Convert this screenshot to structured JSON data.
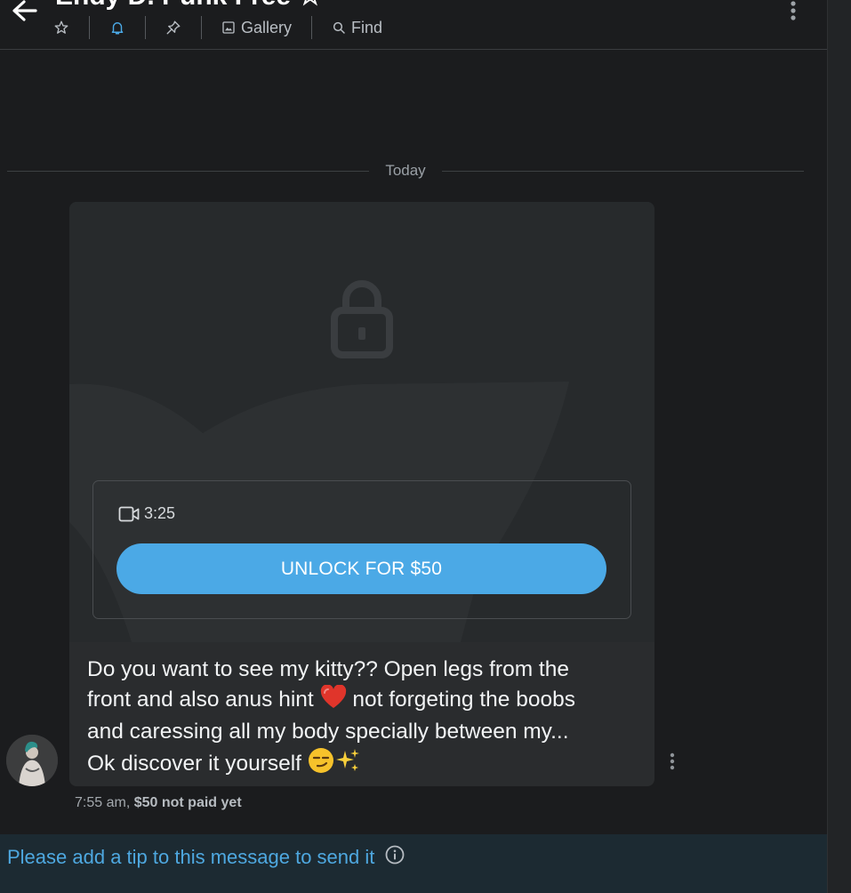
{
  "header": {
    "title": "Endy D. Punk Free ☆",
    "toolbar": {
      "gallery_label": "Gallery",
      "find_label": "Find"
    }
  },
  "chat": {
    "date_divider": "Today",
    "message": {
      "video_duration": "3:25",
      "unlock_label": "UNLOCK FOR $50",
      "text_lines": [
        "Do you want to see my kitty?? Open legs from the",
        "front and also anus hint",
        "not forgeting the boobs",
        "and caressing all my body specially between my...",
        "Ok discover it yourself"
      ],
      "time": "7:55 am,",
      "price_status": "$50 not paid yet"
    }
  },
  "footer": {
    "tip_notice": "Please add a tip to this message to send it"
  },
  "icons": {
    "back": "arrow-left-icon",
    "favorite": "star-icon",
    "notifications": "bell-icon",
    "pin": "pin-icon",
    "gallery": "image-icon",
    "find": "search-icon",
    "menu": "more-vertical-icon",
    "lock": "lock-icon",
    "video": "video-camera-icon",
    "info": "info-icon"
  },
  "colors": {
    "accent": "#4ba9e6",
    "background": "#1b1c1e",
    "bubble": "#2a2c2e",
    "tip_bar": "#1c2a32"
  }
}
